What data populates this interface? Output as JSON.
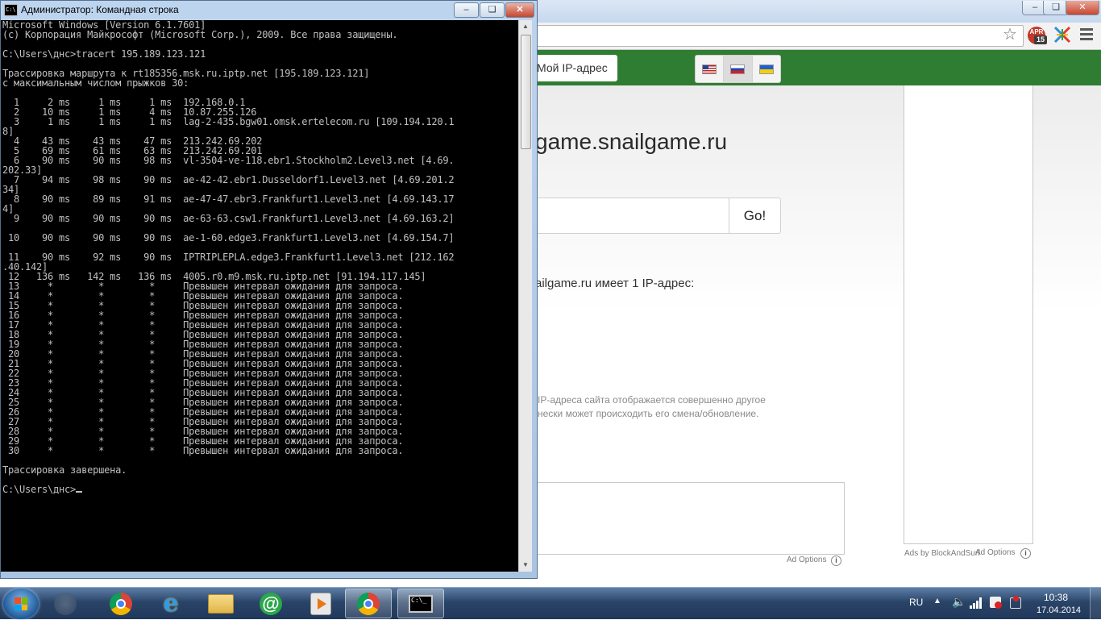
{
  "browser": {
    "tab_myip": "Мой IP-адрес",
    "ext_badge": "15",
    "ext_label": "APR",
    "domain_title": "game.snailgame.ru",
    "go_button": "Go!",
    "result_text": "ailgame.ru имеет 1 IP-адрес:",
    "note_line1": "IP-адреса сайта отображается совершенно другое",
    "note_line2": "нески может происходить его смена/обновление.",
    "ad_options": "Ad Options",
    "ads_by": "Ads by BlockAndSurf",
    "ad_options_side": "Ad Options",
    "languages": [
      "english",
      "russian",
      "ukrainian"
    ],
    "header_color": "#2f7d32"
  },
  "cmd": {
    "title": "Администратор: Командная строка",
    "output": "Microsoft Windows [Version 6.1.7601]\n(c) Корпорация Майкрософт (Microsoft Corp.), 2009. Все права защищены.\n\nC:\\Users\\днс>tracert 195.189.123.121\n\nТрассировка маршрута к rt185356.msk.ru.iptp.net [195.189.123.121]\nс максимальным числом прыжков 30:\n\n  1     2 ms     1 ms     1 ms  192.168.0.1\n  2    10 ms     1 ms     4 ms  10.87.255.126\n  3     1 ms     1 ms     1 ms  lag-2-435.bgw01.omsk.ertelecom.ru [109.194.120.1\n8]\n  4    43 ms    43 ms    47 ms  213.242.69.202\n  5    69 ms    61 ms    63 ms  213.242.69.201\n  6    90 ms    90 ms    98 ms  vl-3504-ve-118.ebr1.Stockholm2.Level3.net [4.69.\n202.33]\n  7    94 ms    98 ms    90 ms  ae-42-42.ebr1.Dusseldorf1.Level3.net [4.69.201.2\n34]\n  8    90 ms    89 ms    91 ms  ae-47-47.ebr3.Frankfurt1.Level3.net [4.69.143.17\n4]\n  9    90 ms    90 ms    90 ms  ae-63-63.csw1.Frankfurt1.Level3.net [4.69.163.2]\n\n 10    90 ms    90 ms    90 ms  ae-1-60.edge3.Frankfurt1.Level3.net [4.69.154.7]\n\n 11    90 ms    92 ms    90 ms  IPTRIPLEPLA.edge3.Frankfurt1.Level3.net [212.162\n.40.142]\n 12   136 ms   142 ms   136 ms  4005.r0.m9.msk.ru.iptp.net [91.194.117.145]\n 13     *        *        *     Превышен интервал ожидания для запроса.\n 14     *        *        *     Превышен интервал ожидания для запроса.\n 15     *        *        *     Превышен интервал ожидания для запроса.\n 16     *        *        *     Превышен интервал ожидания для запроса.\n 17     *        *        *     Превышен интервал ожидания для запроса.\n 18     *        *        *     Превышен интервал ожидания для запроса.\n 19     *        *        *     Превышен интервал ожидания для запроса.\n 20     *        *        *     Превышен интервал ожидания для запроса.\n 21     *        *        *     Превышен интервал ожидания для запроса.\n 22     *        *        *     Превышен интервал ожидания для запроса.\n 23     *        *        *     Превышен интервал ожидания для запроса.\n 24     *        *        *     Превышен интервал ожидания для запроса.\n 25     *        *        *     Превышен интервал ожидания для запроса.\n 26     *        *        *     Превышен интервал ожидания для запроса.\n 27     *        *        *     Превышен интервал ожидания для запроса.\n 28     *        *        *     Превышен интервал ожидания для запроса.\n 29     *        *        *     Превышен интервал ожидания для запроса.\n 30     *        *        *     Превышен интервал ожидания для запроса.\n\nТрассировка завершена.\n\n",
    "prompt": "C:\\Users\\днс>"
  },
  "taskbar": {
    "items": [
      "disabled-app",
      "chrome",
      "internet-explorer",
      "explorer-folder",
      "mail-agent",
      "media-player",
      "chrome",
      "command-prompt"
    ],
    "tray_lang": "RU",
    "time": "10:38",
    "date": "17.04.2014"
  }
}
